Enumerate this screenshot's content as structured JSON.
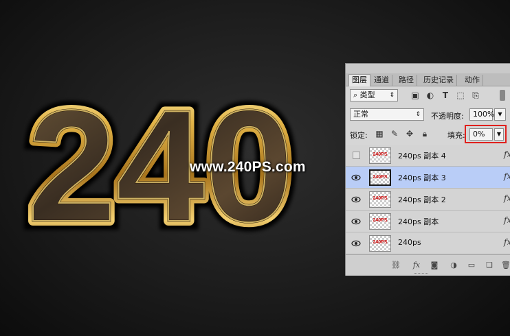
{
  "artwork": {
    "text": "240ps",
    "watermark": "www.240PS.com"
  },
  "panel": {
    "tabs": [
      {
        "label": "图层",
        "active": true
      },
      {
        "label": "通道",
        "active": false
      },
      {
        "label": "路径",
        "active": false
      },
      {
        "label": "历史记录",
        "active": false
      },
      {
        "label": "动作",
        "active": false
      }
    ],
    "filter_kind": "类型",
    "filter_icons": [
      "image-filter-icon",
      "adjustment-filter-icon",
      "type-filter-icon",
      "shape-filter-icon",
      "smart-object-filter-icon"
    ],
    "blend_mode": "正常",
    "opacity_label": "不透明度:",
    "opacity_value": "100%",
    "lock_label": "锁定:",
    "lock_icons": [
      "lock-transparent-icon",
      "lock-image-icon",
      "lock-position-icon",
      "lock-all-icon"
    ],
    "fill_label": "填充:",
    "fill_value": "0%",
    "fill_highlight_color": "#e0201c",
    "selected_color": "#b9cdf7",
    "layers": [
      {
        "name": "240ps 副本 4",
        "visible": false,
        "selected": false,
        "thumb_text": "240PS",
        "has_fx": true
      },
      {
        "name": "240ps 副本 3",
        "visible": true,
        "selected": true,
        "thumb_text": "240PS",
        "has_fx": true
      },
      {
        "name": "240ps 副本 2",
        "visible": true,
        "selected": false,
        "thumb_text": "240PS",
        "has_fx": true
      },
      {
        "name": "240ps 副本",
        "visible": true,
        "selected": false,
        "thumb_text": "240PS",
        "has_fx": true
      },
      {
        "name": "240ps",
        "visible": true,
        "selected": false,
        "thumb_text": "240PS",
        "has_fx": true
      }
    ],
    "fx_label": "fx",
    "footer_icons": [
      "link-icon",
      "fx-icon",
      "mask-icon",
      "adjustment-icon",
      "group-folder-icon",
      "new-layer-icon",
      "trash-icon"
    ]
  }
}
